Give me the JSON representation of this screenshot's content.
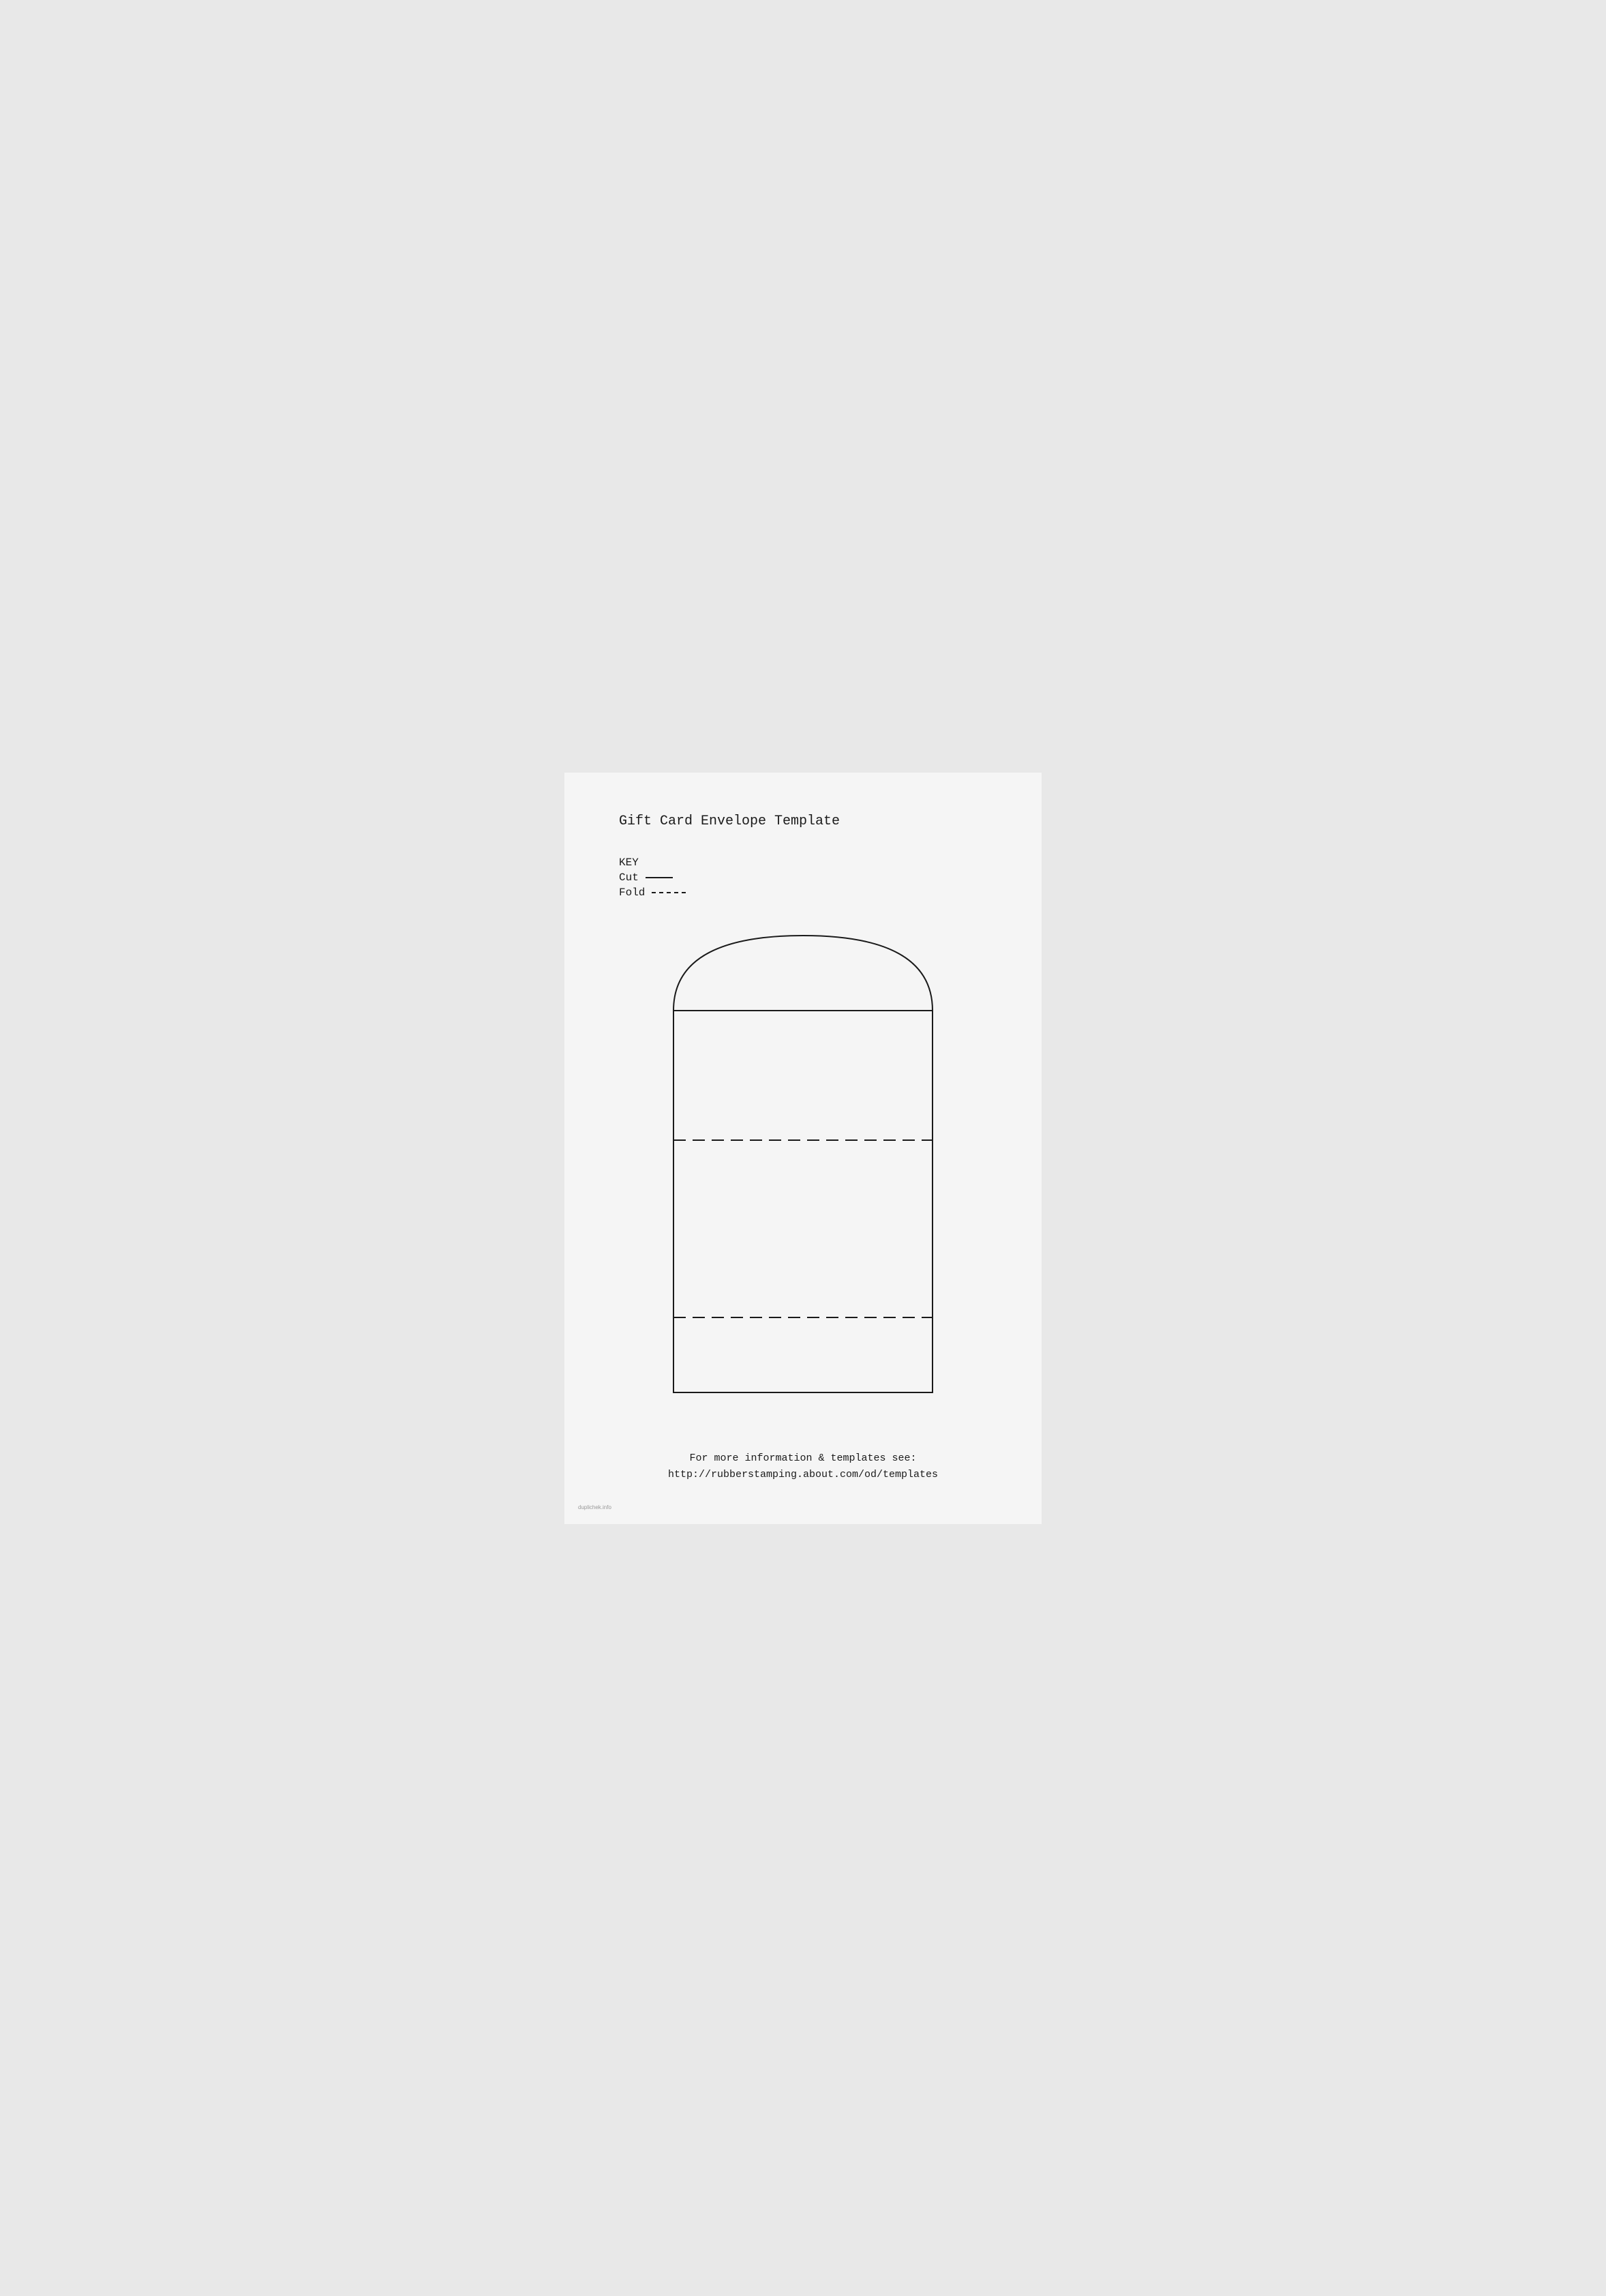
{
  "page": {
    "title": "Gift Card Envelope Template",
    "background_color": "#f5f5f5"
  },
  "key": {
    "heading": "KEY",
    "cut_label": "Cut",
    "fold_label": "Fold"
  },
  "footer": {
    "line1": "For more information & templates see:",
    "line2": "http://rubberstamping.about.com/od/templates"
  },
  "watermark": "duplichek.info"
}
